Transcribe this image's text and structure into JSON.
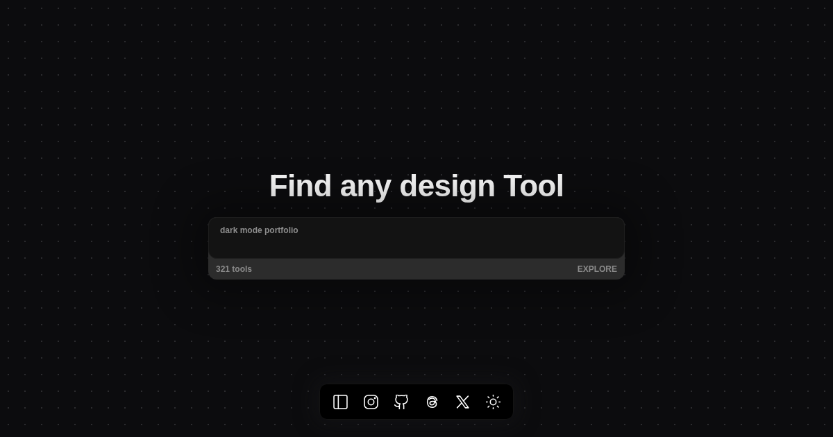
{
  "heading": "Find any design Tool",
  "search": {
    "placeholder": "dark mode portfolio",
    "count": "321 tools",
    "action": "EXPLORE"
  }
}
